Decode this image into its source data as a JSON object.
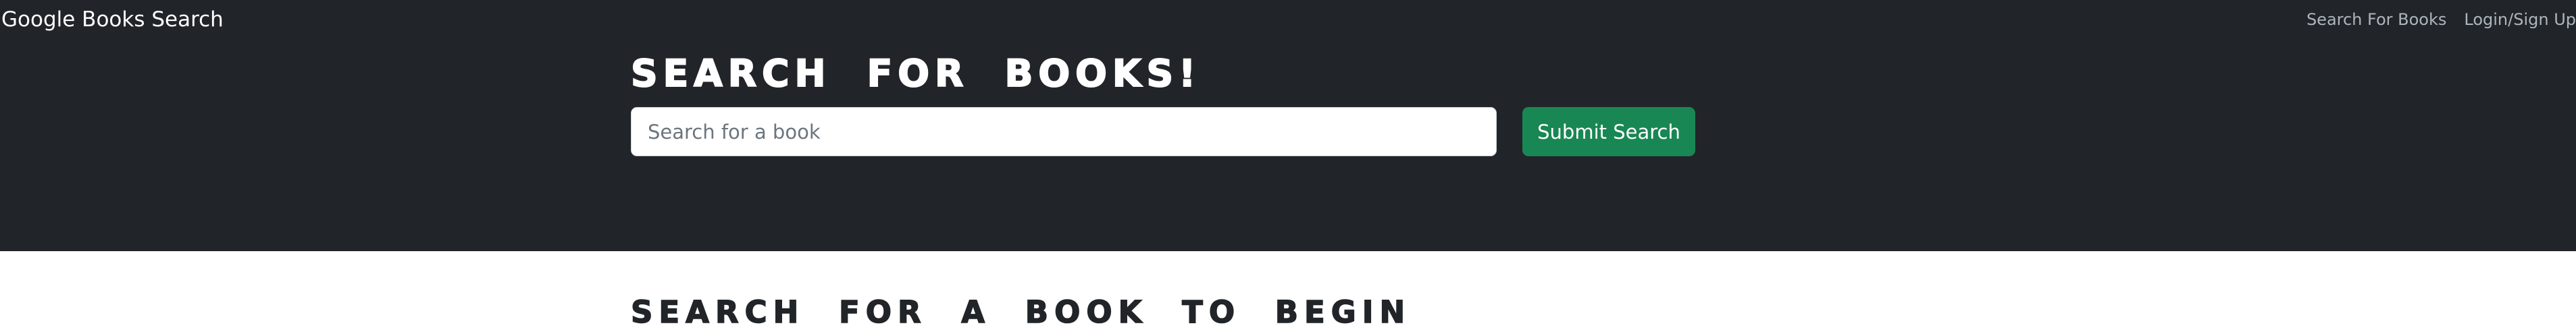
{
  "navbar": {
    "brand": "Google Books Search",
    "links": [
      {
        "label": "Search For Books"
      },
      {
        "label": "Login/Sign Up"
      }
    ],
    "colors": {
      "background": "#212529",
      "brand_text": "#ffffff",
      "link_text": "#adb5bd"
    }
  },
  "hero": {
    "title": "SEARCH FOR BOOKS!",
    "search": {
      "placeholder": "Search for a book",
      "value": ""
    },
    "submit_label": "Submit Search",
    "colors": {
      "background": "#212529",
      "button": "#198754"
    }
  },
  "results": {
    "heading": "SEARCH FOR A BOOK TO BEGIN"
  }
}
